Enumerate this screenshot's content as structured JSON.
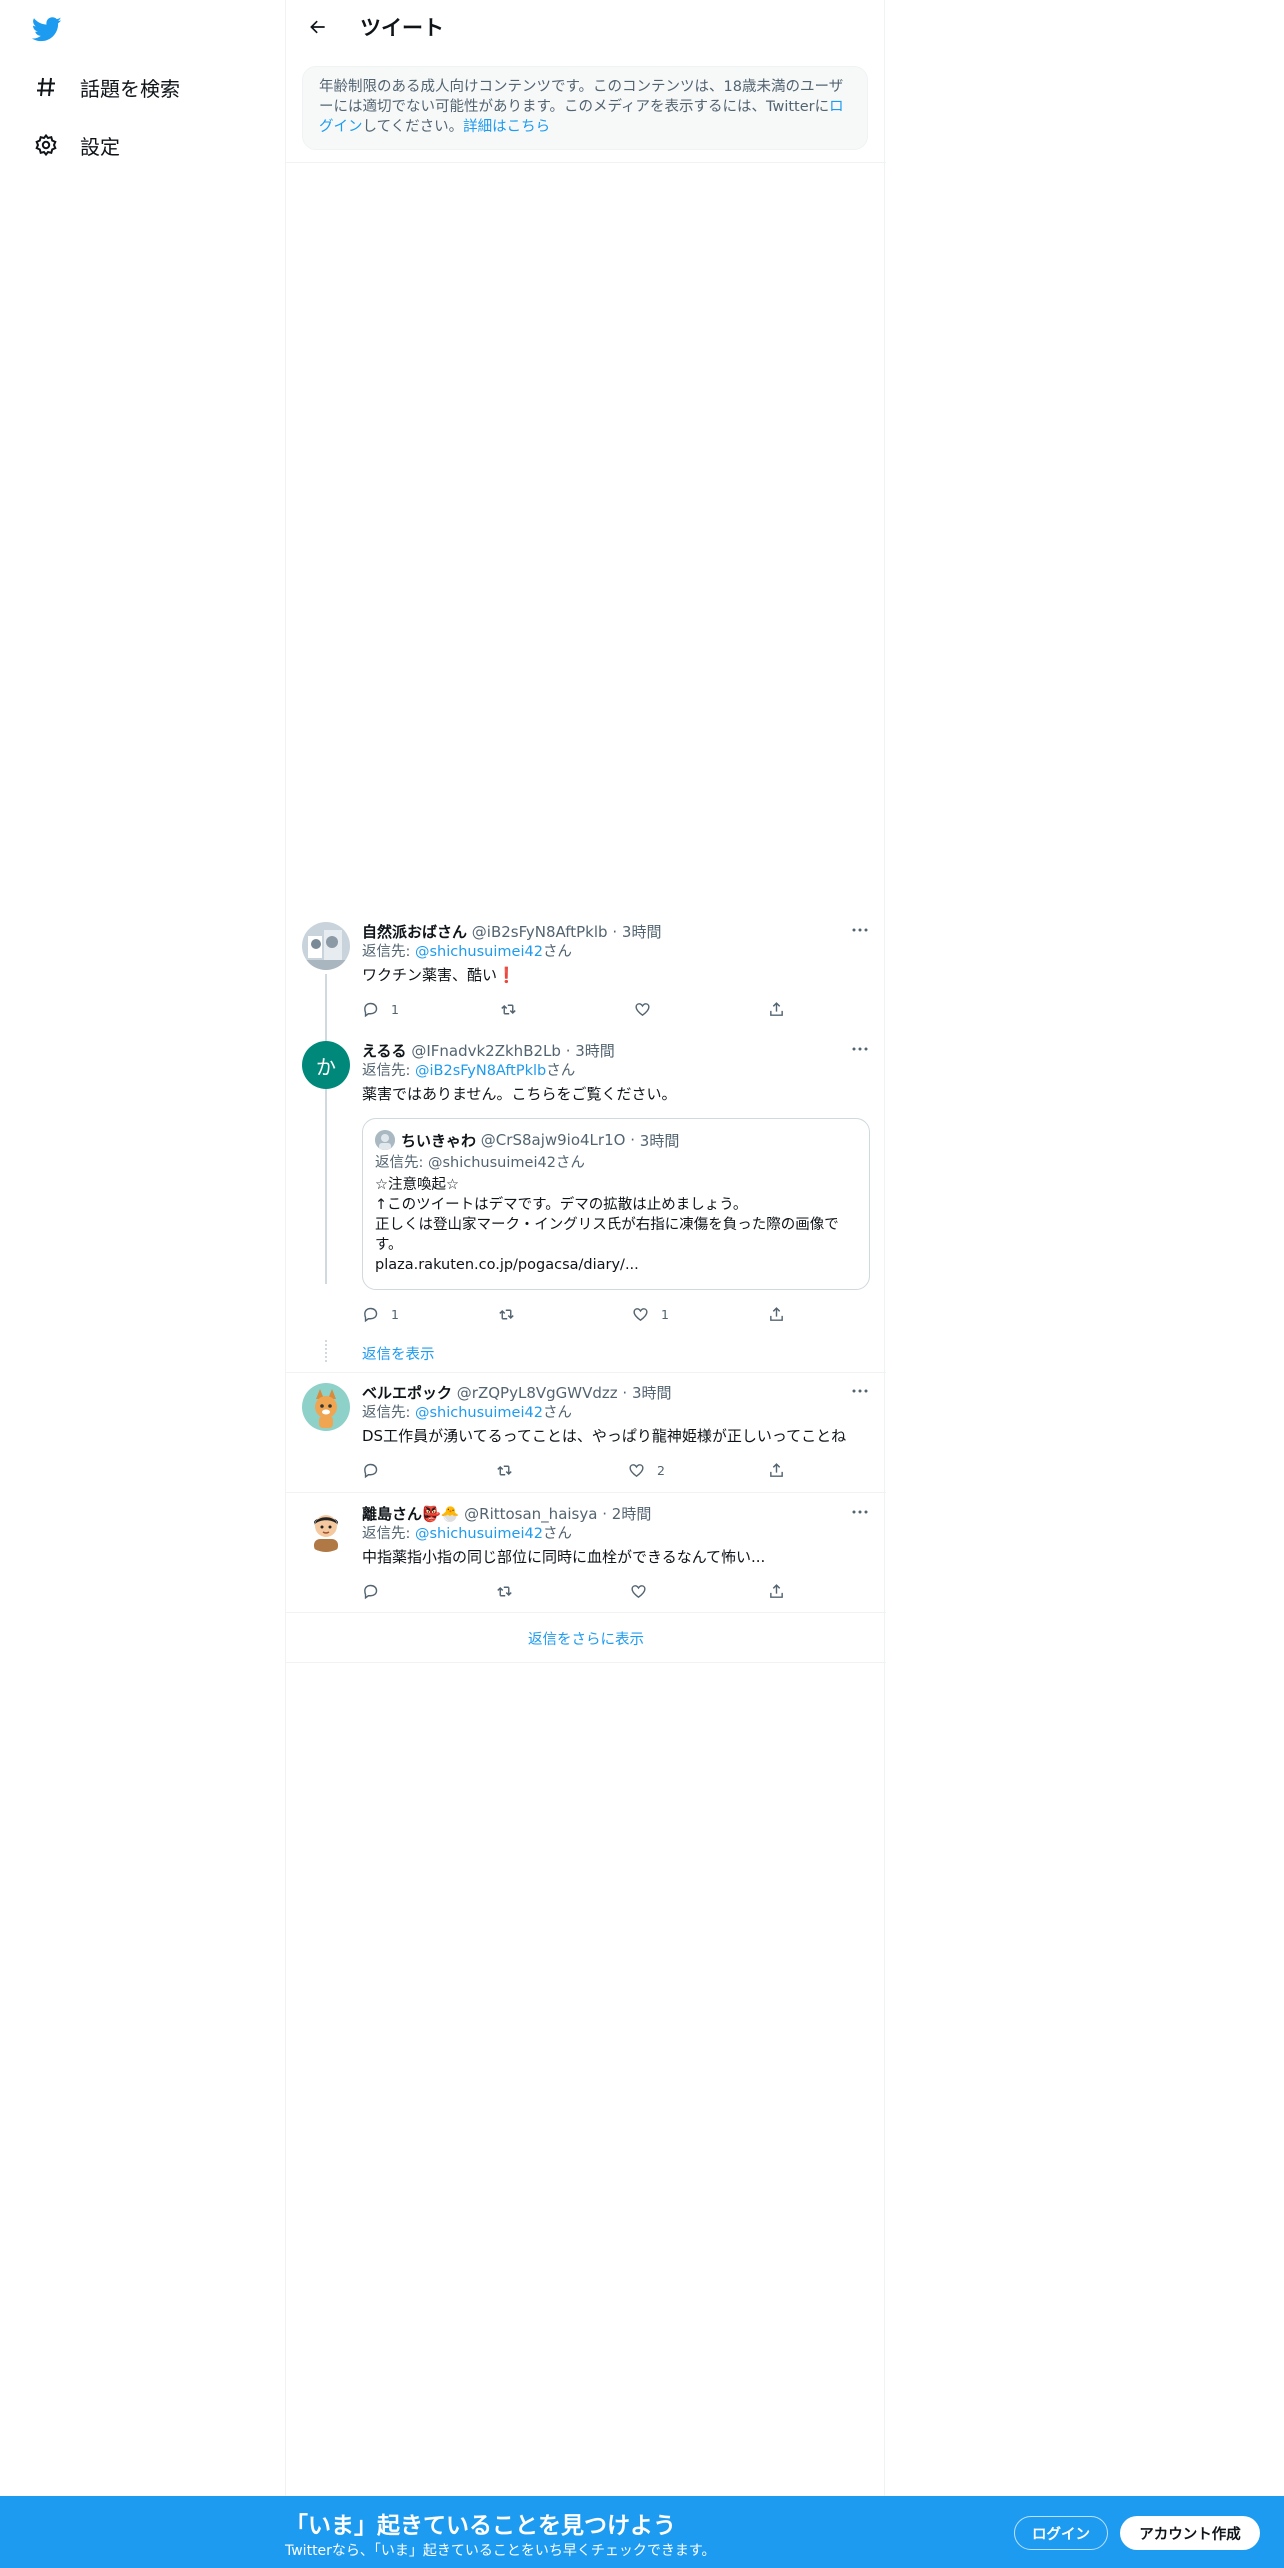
{
  "sidebar": {
    "logo_icon": "twitter-bird-icon",
    "items": [
      {
        "label": "話題を検索",
        "icon": "hashtag-icon"
      },
      {
        "label": "設定",
        "icon": "gear-icon"
      }
    ]
  },
  "header": {
    "title": "ツイート",
    "back_icon": "arrow-left-icon"
  },
  "notice": {
    "text_before": "年齢制限のある成人向けコンテンツです。このコンテンツは、18歳未満のユーザーには適切でない可能性があります。このメディアを表示するには、Twitterに",
    "login_link": "ログイン",
    "text_after": "してください。",
    "details_link": "詳細はこちら"
  },
  "tweets": [
    {
      "name": "自然派おばさん",
      "handle": "@iB2sFyN8AftPklb",
      "time": "3時間",
      "reply_prefix": "返信先: ",
      "reply_handle": "@shichusuimei42",
      "reply_suffix": "さん",
      "text": "ワクチン薬害、酷い❗️",
      "reply_count": "1",
      "retweet_count": "",
      "like_count": ""
    },
    {
      "name": "えるる",
      "handle": "@IFnadvk2ZkhB2Lb",
      "time": "3時間",
      "avatar_letter": "か",
      "reply_prefix": "返信先: ",
      "reply_handle": "@iB2sFyN8AftPklb",
      "reply_suffix": "さん",
      "text": "薬害ではありません。こちらをご覧ください。",
      "reply_count": "1",
      "retweet_count": "",
      "like_count": "1",
      "quote": {
        "name": "ちいきゃわ",
        "handle": "@CrS8ajw9io4Lr1O",
        "time": "3時間",
        "reply_line": "返信先: @shichusuimei42さん",
        "text_1": "☆注意喚起☆",
        "text_2": "↑このツイートはデマです。デマの拡散は止めましょう。",
        "text_3": "正しくは登山家マーク・イングリス氏が右指に凍傷を負った際の画像です。",
        "text_4": "plaza.rakuten.co.jp/pogacsa/diary/..."
      }
    },
    {
      "name": "ベルエポック",
      "handle": "@rZQPyL8VgGWVdzz",
      "time": "3時間",
      "reply_prefix": "返信先: ",
      "reply_handle": "@shichusuimei42",
      "reply_suffix": "さん",
      "text": "DS工作員が湧いてるってことは、やっぱり龍神姫様が正しいってことね",
      "reply_count": "",
      "retweet_count": "",
      "like_count": "2"
    },
    {
      "name": "離島さん👺🐣",
      "handle": "@Rittosan_haisya",
      "time": "2時間",
      "reply_prefix": "返信先: ",
      "reply_handle": "@shichusuimei42",
      "reply_suffix": "さん",
      "text": "中指薬指小指の同じ部位に同時に血栓ができるなんて怖い...",
      "reply_count": "",
      "retweet_count": "",
      "like_count": ""
    }
  ],
  "show_replies": "返信を表示",
  "more_replies": "返信をさらに表示",
  "separator_dot": "·",
  "banner": {
    "title": "「いま」起きていることを見つけよう",
    "subtitle": "Twitterなら、「いま」起きていることをいち早くチェックできます。",
    "login_label": "ログイン",
    "signup_label": "アカウント作成"
  },
  "colors": {
    "accent": "#1d9bf0",
    "text": "#0f1419",
    "muted": "#536471",
    "border": "#eff3f4"
  }
}
